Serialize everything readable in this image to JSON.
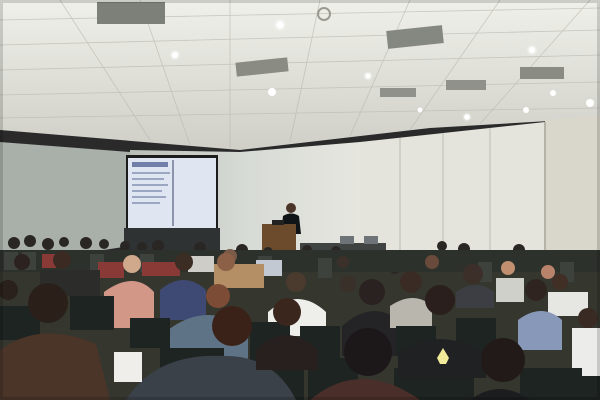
{
  "scene": {
    "colors": {
      "ceiling": "#e6e6e0",
      "wall": "#d4d8d2",
      "panel_wall": "#e3e3dc",
      "screen": "#dfe6f2",
      "screen_frame": "#1c1c1c",
      "stage": "#3b3f3f",
      "podium": "#6b4b2c",
      "seat": "#1e2422",
      "floor": "#3a3a36"
    }
  }
}
